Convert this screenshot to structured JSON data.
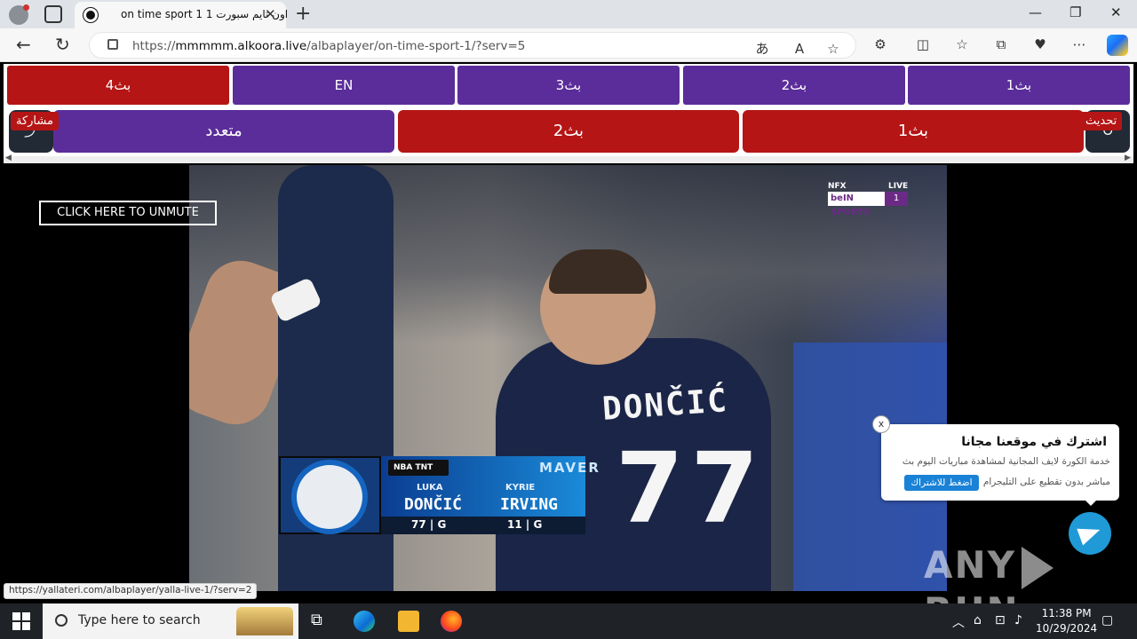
{
  "browser": {
    "tab_title": "on time sport 1 اون تايم سبورت 1",
    "new_tab": "+",
    "url_domain": "mmmmm.alkoora.live",
    "url_prefix": "https://",
    "url_path": "/albaplayer/on-time-sport-1/?serv=5",
    "window_buttons": [
      "—",
      "❐",
      "✕"
    ]
  },
  "servers": {
    "row1": [
      {
        "label": "بث4",
        "color": "#b51515"
      },
      {
        "label": "EN",
        "color": "#5b2d9a"
      },
      {
        "label": "بث3",
        "color": "#5b2d9a"
      },
      {
        "label": "بث2",
        "color": "#5b2d9a"
      },
      {
        "label": "بث1",
        "color": "#5b2d9a"
      }
    ],
    "row2": [
      {
        "label": "متعدد",
        "color": "#5b2d9a"
      },
      {
        "label": "بث2",
        "color": "#b51515"
      },
      {
        "label": "بث1",
        "color": "#b51515"
      }
    ],
    "share_label": "مشاركة",
    "refresh_label": "تحديث",
    "share_icon": "⤴",
    "refresh_icon": "↻"
  },
  "video": {
    "unmute_label": "CLICK HERE TO UNMUTE",
    "channel_logo": "beIN SPORTS",
    "channel_number": "1",
    "live_label": "LIVE",
    "nfx_label": "NFX",
    "jersey_name": "DONČIĆ",
    "jersey_number": "77",
    "graphic": {
      "league": "NBA TNT",
      "team": "MAVER",
      "player1_first": "LUKA",
      "player1_last": "DONČIĆ",
      "player1_stat": "77 | G",
      "player2_first": "KYRIE",
      "player2_last": "IRVING",
      "player2_stat": "11 | G"
    }
  },
  "popup": {
    "title": "اشترك في موقعنا مجانا",
    "line1": "خدمة الكورة لايف المجانية لمشاهدة مباريات اليوم بث",
    "line2": "مباشر بدون تقطيع على التليجرام",
    "button": "اضغط للاشتراك",
    "close": "x"
  },
  "watermark": {
    "left": "ANY",
    "right": "RUN"
  },
  "status_link": "https://yallateri.com/albaplayer/yalla-live-1/?serv=2",
  "taskbar": {
    "search_placeholder": "Type here to search",
    "time": "11:38 PM",
    "date": "10/29/2024"
  }
}
